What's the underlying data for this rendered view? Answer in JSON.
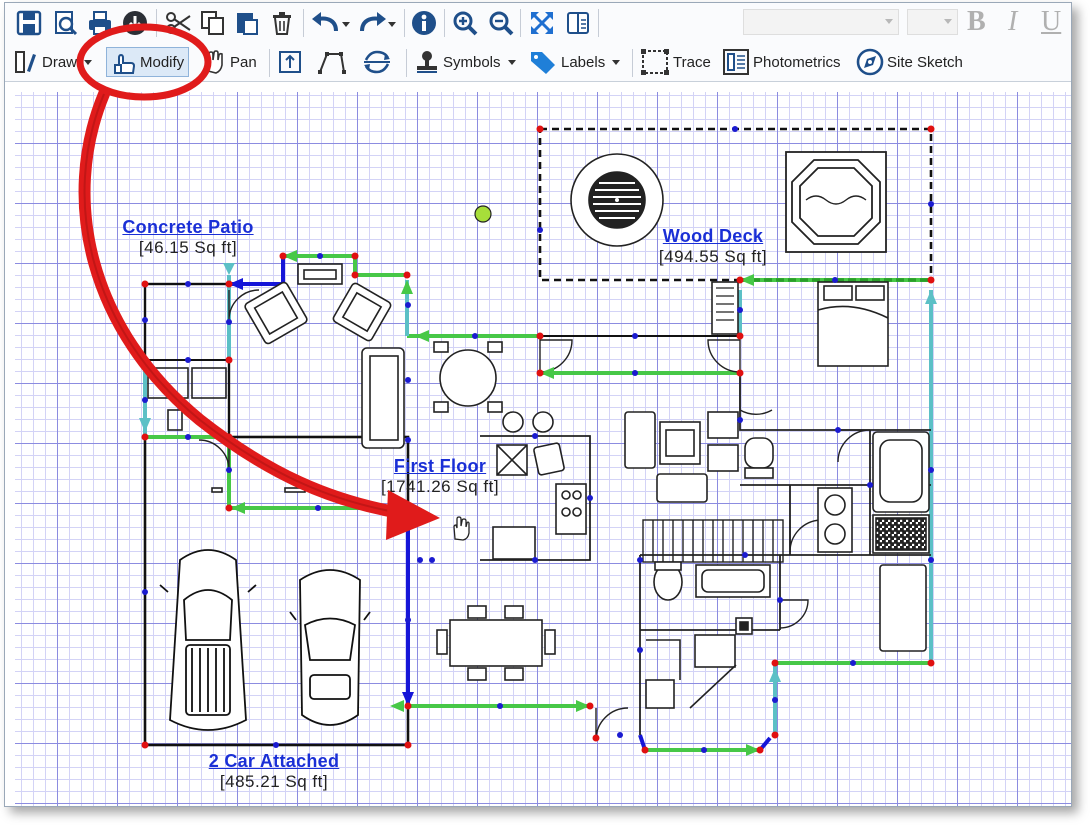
{
  "toolbar": {
    "icons": [
      "save-icon",
      "print-preview-icon",
      "print-icon",
      "download-icon",
      "cut-icon",
      "copy-icon",
      "paste-icon",
      "delete-icon",
      "undo-icon",
      "redo-icon",
      "info-icon",
      "zoom-in-icon",
      "zoom-out-icon",
      "fit-to-window-icon",
      "compare-icon"
    ],
    "format": {
      "bold": "B",
      "italic": "I",
      "underline": "U"
    }
  },
  "tools": {
    "draw": "Draw",
    "modify": "Modify",
    "pan": "Pan",
    "symbols": "Symbols",
    "labels": "Labels",
    "trace": "Trace",
    "photometrics": "Photometrics",
    "site_sketch": "Site Sketch"
  },
  "areas": {
    "concrete_patio": {
      "name": "Concrete Patio",
      "area": "[46.15 Sq ft]"
    },
    "wood_deck": {
      "name": "Wood Deck",
      "area": "[494.55 Sq ft]"
    },
    "first_floor": {
      "name": "First Floor",
      "area": "[1741.26 Sq ft]"
    },
    "garage": {
      "name": "2 Car Attached",
      "area": "[485.21 Sq ft]"
    }
  },
  "colors": {
    "accent_red": "#e01b1b",
    "label_blue": "#1a2fd6",
    "line_green": "#2db32d",
    "line_blue": "#1515d8",
    "line_teal": "#5cc0c6",
    "vertex_red": "#e01010",
    "vertex_blue": "#1b1bd0"
  }
}
